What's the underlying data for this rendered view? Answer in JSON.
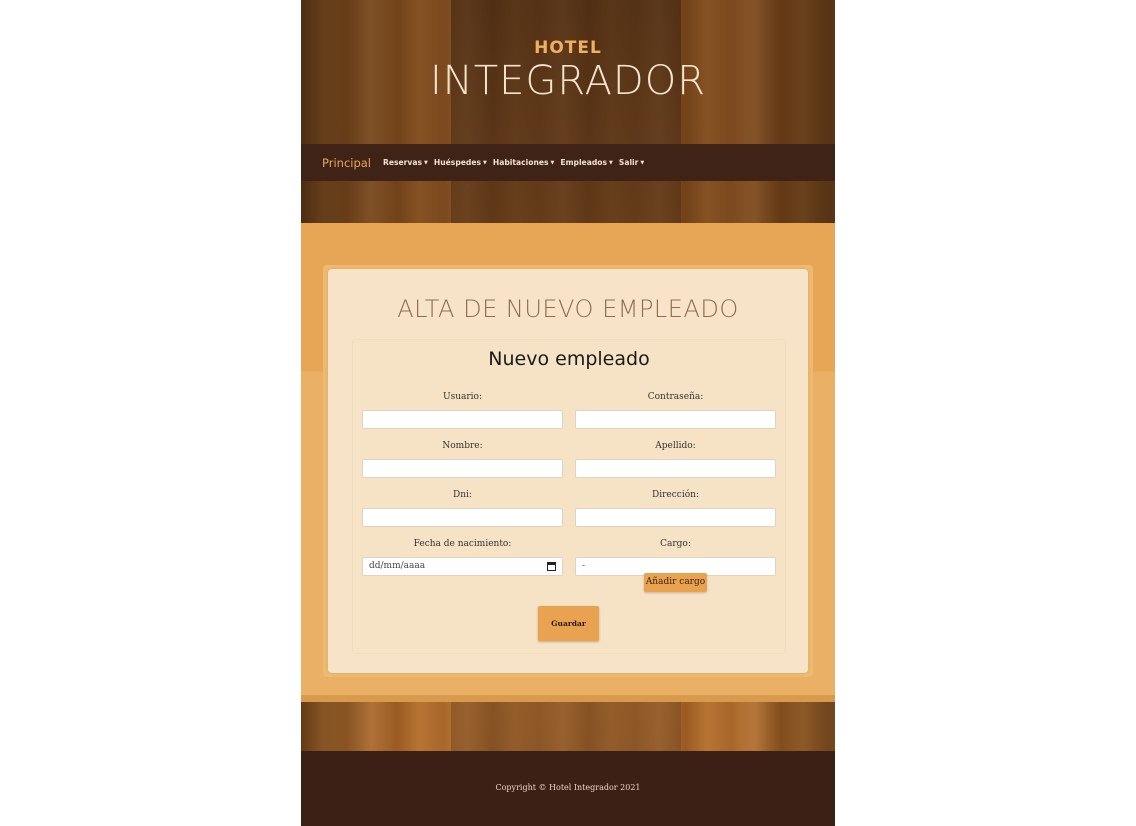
{
  "header": {
    "brand_small": "HOTEL",
    "brand_big": "INTEGRADOR"
  },
  "nav": {
    "brand": "Principal",
    "items": [
      {
        "label": "Reservas"
      },
      {
        "label": "Huéspedes"
      },
      {
        "label": "Habitaciones"
      },
      {
        "label": "Empleados"
      },
      {
        "label": "Salir"
      }
    ]
  },
  "main": {
    "title": "ALTA DE NUEVO EMPLEADO",
    "form": {
      "title": "Nuevo empleado",
      "fields": {
        "usuario": {
          "label": "Usuario:",
          "value": ""
        },
        "contrasena": {
          "label": "Contraseña:",
          "value": ""
        },
        "nombre": {
          "label": "Nombre:",
          "value": ""
        },
        "apellido": {
          "label": "Apellido:",
          "value": ""
        },
        "dni": {
          "label": "Dni:",
          "value": ""
        },
        "direccion": {
          "label": "Dirección:",
          "value": ""
        },
        "fecha": {
          "label": "Fecha de nacimiento:",
          "value": "dd/mm/aaaa"
        },
        "cargo": {
          "label": "Cargo:",
          "value": "-"
        }
      },
      "add_cargo_label": "Añadir cargo",
      "save_label": "Guardar"
    }
  },
  "footer": {
    "copyright": "Copyright © Hotel Integrador 2021"
  }
}
